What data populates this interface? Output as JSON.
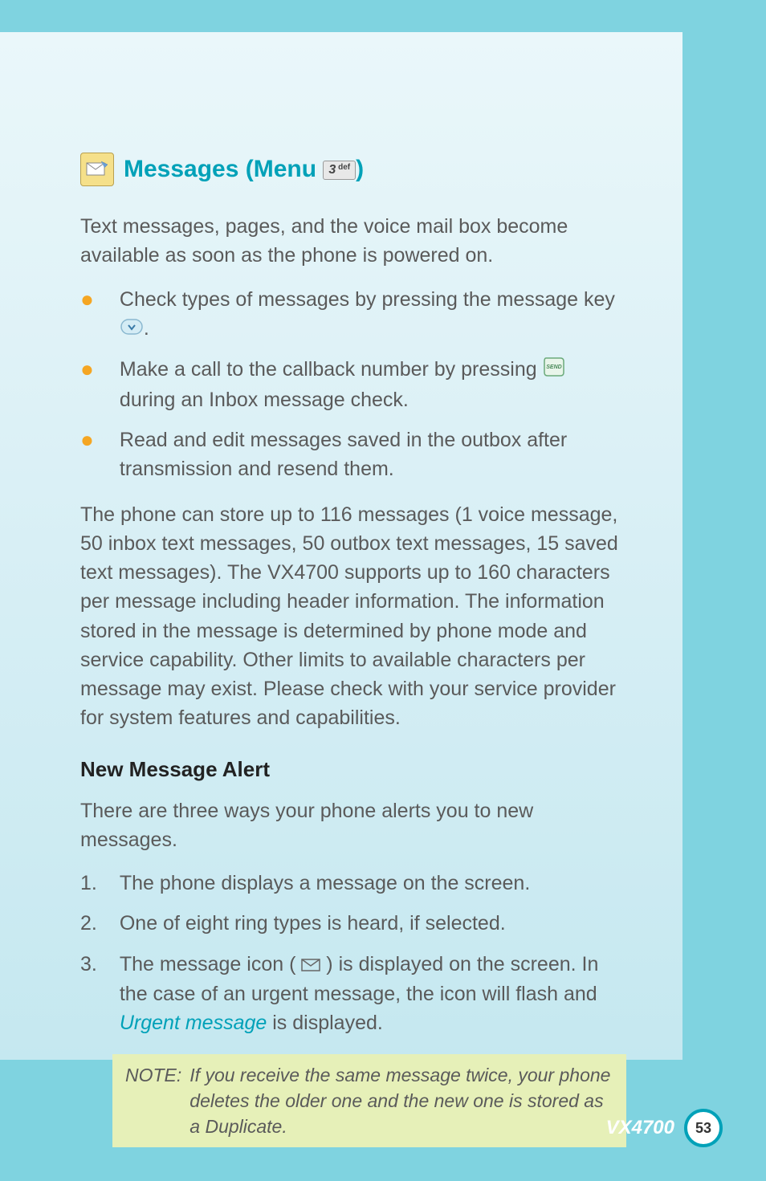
{
  "section": {
    "title_prefix": "Messages (Menu ",
    "key_label": "3 def",
    "title_suffix": ")"
  },
  "intro": "Text messages, pages, and the voice mail box become available as soon as the phone is powered on.",
  "bullets": [
    {
      "pre": "Check types of messages by pressing the message key ",
      "post": "."
    },
    {
      "pre": "Make a call to the callback number by pressing ",
      "post": " during an Inbox message check."
    },
    {
      "text": "Read and edit messages saved in the outbox after transmission and resend them."
    }
  ],
  "storage": "The phone can store up to 116 messages (1 voice message, 50 inbox text messages, 50 outbox text messages, 15 saved text messages). The VX4700 supports up to 160 characters per message including header information. The information stored in the message is determined by phone mode and service capability. Other limits to available characters per message may exist. Please check with your service provider for system features and capabilities.",
  "subsection_title": "New Message Alert",
  "subsection_intro": "There are three ways your phone alerts you to new messages.",
  "numbered": [
    {
      "num": "1.",
      "text": "The phone displays a message on the screen."
    },
    {
      "num": "2.",
      "text": "One of eight ring types is heard, if selected."
    },
    {
      "num": "3.",
      "pre": "The message icon ( ",
      "post": " ) is displayed on the screen. In the case of an urgent message, the icon will flash and ",
      "italic": "Urgent message",
      "tail": " is displayed."
    }
  ],
  "note": {
    "label": "NOTE:",
    "text": "If you receive the same message twice, your phone deletes the older one and the new one is stored as a Duplicate."
  },
  "footer": {
    "model": "VX4700",
    "page": "53"
  }
}
